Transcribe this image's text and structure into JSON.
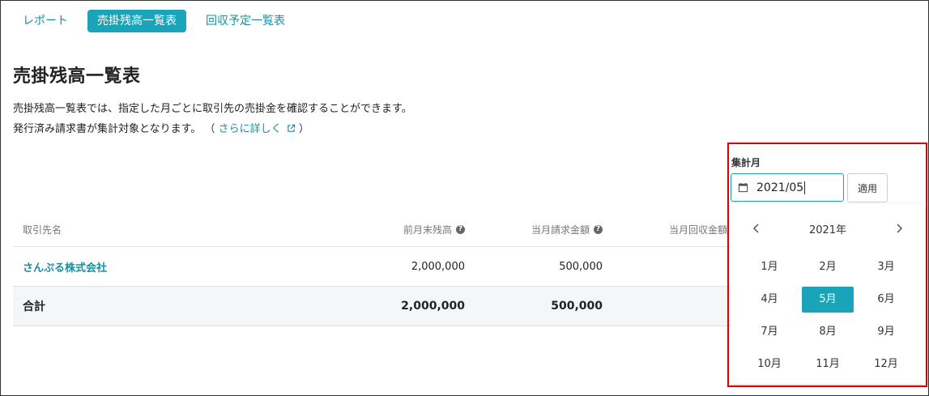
{
  "nav": {
    "report": "レポート",
    "receivable_balance": "売掛残高一覧表",
    "collection_schedule": "回収予定一覧表"
  },
  "page": {
    "title": "売掛残高一覧表",
    "desc_line1": "売掛残高一覧表では、指定した月ごとに取引先の売掛金を確認することができます。",
    "desc_line2": "発行済み請求書が集計対象となります。",
    "paren_open": "（",
    "more_link": "さらに詳しく",
    "paren_close": "）"
  },
  "table": {
    "headers": {
      "client": "取引先名",
      "prev_balance": "前月末残高",
      "month_billing": "当月請求金額",
      "month_collection": "当月回収金額"
    },
    "rows": [
      {
        "client": "さんぷる株式会社",
        "prev_balance": "2,000,000",
        "month_billing": "500,000"
      }
    ],
    "total": {
      "label": "合計",
      "prev_balance": "2,000,000",
      "month_billing": "500,000"
    }
  },
  "filter": {
    "label": "集計月",
    "value": "2021/05",
    "apply": "適用"
  },
  "picker": {
    "year": "2021年",
    "months": [
      "1月",
      "2月",
      "3月",
      "4月",
      "5月",
      "6月",
      "7月",
      "8月",
      "9月",
      "10月",
      "11月",
      "12月"
    ],
    "selected_month": "5月"
  },
  "colors": {
    "accent": "#19a4b9",
    "link": "#1a8ea0",
    "highlight": "#e00000"
  }
}
